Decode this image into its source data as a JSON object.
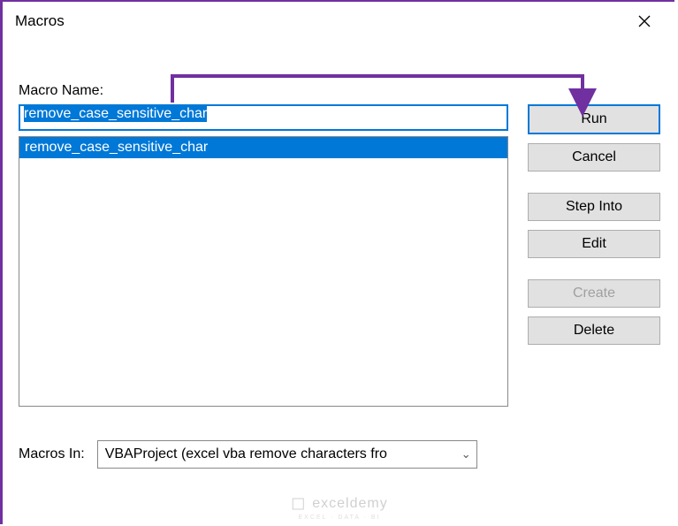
{
  "titlebar": {
    "title": "Macros"
  },
  "labels": {
    "macro_name": "Macro Name:",
    "macros_in": "Macros In:"
  },
  "macro_name_input": "remove_case_sensitive_char",
  "macro_list": {
    "selected_index": 0,
    "items": [
      "remove_case_sensitive_char"
    ]
  },
  "buttons": {
    "run": "Run",
    "cancel": "Cancel",
    "step_into": "Step Into",
    "edit": "Edit",
    "create": "Create",
    "delete": "Delete"
  },
  "macros_in_dropdown": {
    "selected": "VBAProject (excel vba remove characters fro"
  },
  "watermark": {
    "main": "exceldemy",
    "sub": "EXCEL · DATA · BI"
  },
  "colors": {
    "accent": "#0078d7",
    "annotation": "#7030a0"
  }
}
